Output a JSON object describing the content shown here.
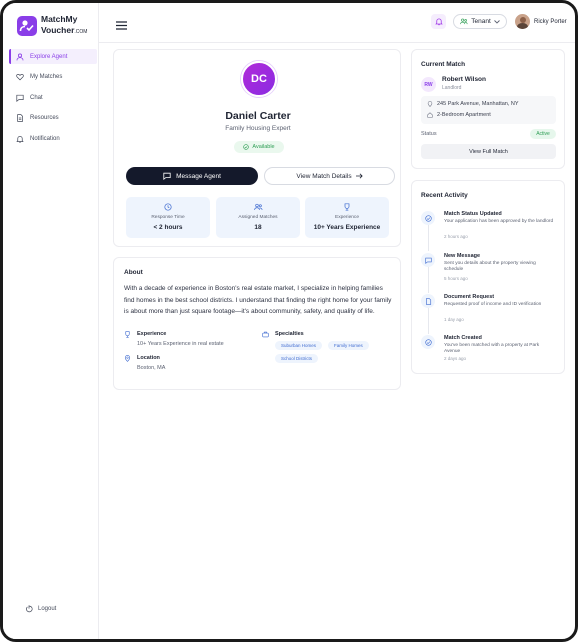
{
  "brand": {
    "name_line1": "MatchMy",
    "name_line2": "Voucher",
    "name_suffix": ".COM"
  },
  "sidebar": {
    "items": [
      {
        "label": "Explore Agent",
        "icon": "user-icon",
        "active": true
      },
      {
        "label": "My Matches",
        "icon": "heart-icon",
        "active": false
      },
      {
        "label": "Chat",
        "icon": "chat-icon",
        "active": false
      },
      {
        "label": "Resources",
        "icon": "document-icon",
        "active": false
      },
      {
        "label": "Notification",
        "icon": "bell-icon",
        "active": false
      }
    ],
    "logout_label": "Logout"
  },
  "header": {
    "role": "Tenant",
    "user_name": "Ricky Porter",
    "accent": "#8a3ee8"
  },
  "profile": {
    "initials": "DC",
    "name": "Daniel Carter",
    "title": "Family Housing Expert",
    "status": "Available",
    "message_button": "Message Agent",
    "details_button": "View Match Details",
    "stats": [
      {
        "label": "Response Time",
        "value": "< 2 hours",
        "icon": "clock-icon"
      },
      {
        "label": "Assigned Matches",
        "value": "18",
        "icon": "users-icon"
      },
      {
        "label": "Experience",
        "value": "10+ Years Experience",
        "icon": "award-icon"
      }
    ]
  },
  "about": {
    "title": "About",
    "text": "With a decade of experience in Boston's real estate market, I specialize in helping families find homes in the best school districts. I understand that finding the right home for your family is about more than just square footage—it's about community, safety, and quality of life.",
    "experience_label": "Experience",
    "experience_value": "10+ Years Experience in real estate",
    "location_label": "Location",
    "location_value": "Boston, MA",
    "specialties_label": "Specialties",
    "specialties": [
      "Suburban Homes",
      "Family Homes",
      "School Districts"
    ]
  },
  "current_match": {
    "title": "Current Match",
    "initials": "RW",
    "name": "Robert Wilson",
    "role": "Landlord",
    "address": "245 Park Avenue, Manhattan, NY",
    "unit": "2-Bedroom Apartment",
    "status_label": "Status",
    "status_value": "Active",
    "button": "View Full Match"
  },
  "recent_activity": {
    "title": "Recent Activity",
    "items": [
      {
        "title": "Match Status Updated",
        "desc": "Your application has been approved by the landlord",
        "time": "2 hours ago",
        "icon": "check-circle-icon"
      },
      {
        "title": "New Message",
        "desc": "Sent you details about the property viewing schedule",
        "time": "5 hours ago",
        "icon": "message-icon"
      },
      {
        "title": "Document Request",
        "desc": "Requested proof of income and ID verification",
        "time": "1 day ago",
        "icon": "file-icon"
      },
      {
        "title": "Match Created",
        "desc": "You've been matched with a property at Park Avenue",
        "time": "2 days ago",
        "icon": "check-circle-icon"
      }
    ]
  }
}
